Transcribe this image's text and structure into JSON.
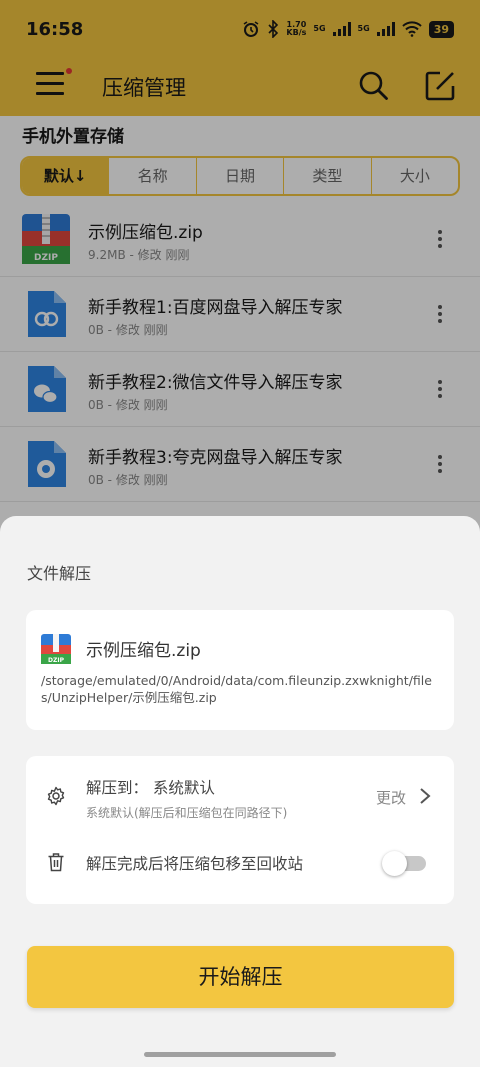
{
  "status_bar": {
    "time": "16:58",
    "net_speed_value": "1.70",
    "net_speed_unit": "KB/s",
    "sim1": "5G",
    "sim2": "5G",
    "battery": "39"
  },
  "toolbar": {
    "title": "压缩管理",
    "icons": [
      "menu-icon",
      "search-icon",
      "edit-icon"
    ]
  },
  "storage_label": "手机外置存储",
  "sort_tabs": [
    {
      "label": "默认↓",
      "selected": true
    },
    {
      "label": "名称",
      "selected": false
    },
    {
      "label": "日期",
      "selected": false
    },
    {
      "label": "类型",
      "selected": false
    },
    {
      "label": "大小",
      "selected": false
    }
  ],
  "files": [
    {
      "name": "示例压缩包.zip",
      "meta": "9.2MB - 修改 刚刚",
      "icon": "zip-file-icon"
    },
    {
      "name": "新手教程1:百度网盘导入解压专家",
      "meta": "0B - 修改 刚刚",
      "icon": "baidu-doc-icon"
    },
    {
      "name": "新手教程2:微信文件导入解压专家",
      "meta": "0B - 修改 刚刚",
      "icon": "wechat-doc-icon"
    },
    {
      "name": "新手教程3:夸克网盘导入解压专家",
      "meta": "0B - 修改 刚刚",
      "icon": "quark-doc-icon"
    }
  ],
  "sheet": {
    "title": "文件解压",
    "file_name": "示例压缩包.zip",
    "file_path": "/storage/emulated/0/Android/data/com.fileunzip.zxwknight/files/UnzipHelper/示例压缩包.zip",
    "extract_to_label": "解压到：  系统默认",
    "extract_to_sub": "系统默认(解压后和压缩包在同路径下)",
    "change_label": "更改",
    "delete_after_label": "解压完成后将压缩包移至回收站",
    "delete_after_enabled": false,
    "start_button": "开始解压"
  },
  "colors": {
    "accent": "#f3c640",
    "sheet_bg": "#f2f2f2"
  }
}
